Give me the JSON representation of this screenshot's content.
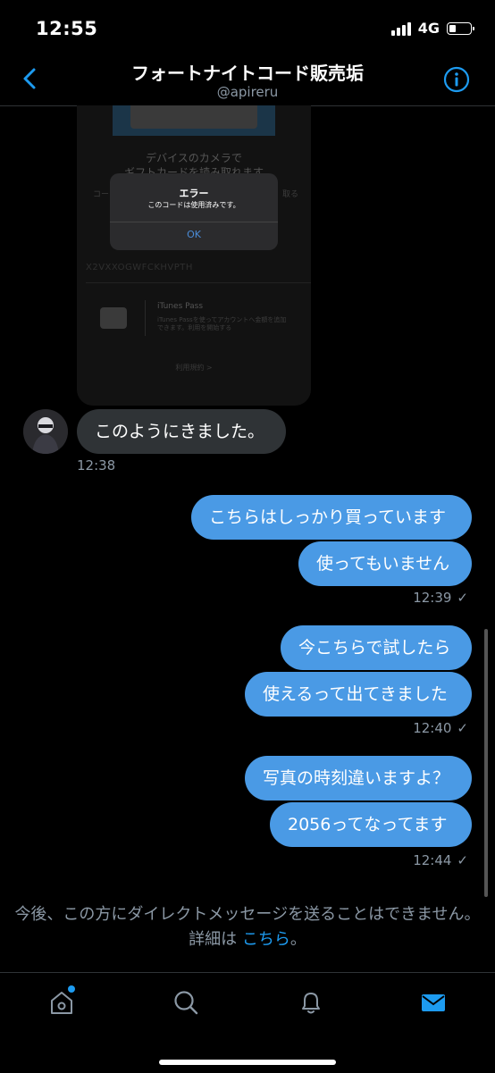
{
  "status_bar": {
    "time": "12:55",
    "network": "4G"
  },
  "header": {
    "title": "フォートナイトコード販売垢",
    "subtitle": "@apireru"
  },
  "attached_screenshot": {
    "camera_text_line1": "デバイスのカメラで",
    "camera_text_line2": "ギフトカードを読み取れます",
    "side_left": "コー",
    "side_right": "取る",
    "alert": {
      "title": "エラー",
      "message": "このコードは使用済みです。",
      "ok": "OK"
    },
    "code_text": "X2VXXOGWFCKHVPTH",
    "pass_title": "iTunes Pass",
    "pass_desc": "iTunes Passを使ってアカウントへ金額を追加できます。利用を開始する",
    "terms": "利用規約 >"
  },
  "messages": [
    {
      "direction": "received",
      "text": "このようにきました。"
    },
    {
      "direction": "sent",
      "text": "こちらはしっかり買っています"
    },
    {
      "direction": "sent",
      "text": "使ってもいません"
    },
    {
      "direction": "sent",
      "text": "今こちらで試したら"
    },
    {
      "direction": "sent",
      "text": "使えるって出てきました"
    },
    {
      "direction": "sent",
      "text": "写真の時刻違いますよ？"
    },
    {
      "direction": "sent",
      "text": "2056ってなってます"
    }
  ],
  "timestamps": {
    "t1": "12:38",
    "t2": "12:39",
    "t3": "12:40",
    "t4": "12:44",
    "check": "✓"
  },
  "footer": {
    "notice_text": "今後、この方にダイレクトメッセージを送ることはできません。詳細は ",
    "link_text": "こちら",
    "notice_end": "。"
  },
  "tabbar": {
    "icons": [
      "home-icon",
      "search-icon",
      "notifications-icon",
      "messages-icon"
    ],
    "active": "messages-icon",
    "accent": "#1d9bf0"
  },
  "colors": {
    "sent_bubble": "#4a9ae5",
    "received_bubble": "#2f3336",
    "link": "#1d9bf0"
  }
}
